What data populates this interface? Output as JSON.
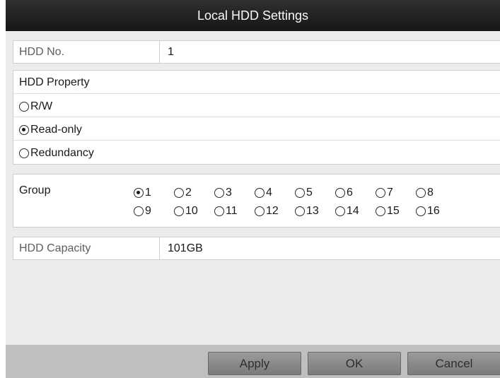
{
  "dialog": {
    "title": "Local HDD Settings"
  },
  "hdd_no": {
    "label": "HDD No.",
    "value": "1"
  },
  "hdd_property": {
    "heading": "HDD Property",
    "options": [
      {
        "label": "R/W",
        "selected": false
      },
      {
        "label": "Read-only",
        "selected": true
      },
      {
        "label": "Redundancy",
        "selected": false
      }
    ]
  },
  "group": {
    "label": "Group",
    "options": [
      "1",
      "2",
      "3",
      "4",
      "5",
      "6",
      "7",
      "8",
      "9",
      "10",
      "11",
      "12",
      "13",
      "14",
      "15",
      "16"
    ],
    "selected": "1"
  },
  "hdd_capacity": {
    "label": "HDD Capacity",
    "value": "101GB"
  },
  "buttons": {
    "apply": "Apply",
    "ok": "OK",
    "cancel": "Cancel"
  }
}
